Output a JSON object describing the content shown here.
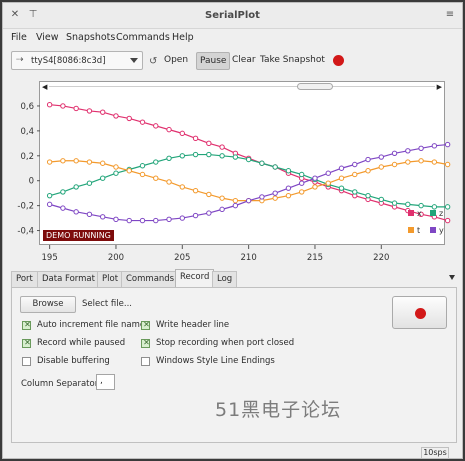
{
  "window": {
    "title": "SerialPlot",
    "close_glyph": "✕",
    "pin_glyph": "⊤",
    "menu_glyph": "≡"
  },
  "menubar": [
    "File",
    "View",
    "Snapshots",
    "Commands",
    "Help"
  ],
  "toolbar": {
    "port": "ttyS4[8086:8c3d]",
    "usb_glyph": "⇢",
    "refresh_glyph": "↺",
    "open_label": "Open",
    "pause_label": "Pause",
    "clear_label": "Clear",
    "snapshot_label": "Take Snapshot",
    "record_color": "#d21818"
  },
  "plot_status": "DEMO RUNNING",
  "scroll": {
    "left_arrow": "◀",
    "right_arrow": "▶"
  },
  "chart_data": {
    "type": "line",
    "xlim": [
      194.5,
      224.5
    ],
    "ylim": [
      -0.5,
      0.72
    ],
    "x_ticks": [
      195,
      200,
      205,
      210,
      215,
      220
    ],
    "y_ticks": [
      0.6,
      0.4,
      0.2,
      0,
      -0.2,
      -0.4
    ],
    "y_tick_labels": [
      "0,6",
      "0,4",
      "0,2",
      "0",
      "-0,2",
      "-0,4"
    ],
    "grid": false,
    "legend": "bottom-right",
    "series": [
      {
        "name": "x",
        "color": "#e0306e",
        "start": 195,
        "step": 1,
        "values": [
          0.61,
          0.6,
          0.58,
          0.56,
          0.55,
          0.52,
          0.5,
          0.47,
          0.44,
          0.41,
          0.38,
          0.34,
          0.3,
          0.27,
          0.22,
          0.18,
          0.14,
          0.11,
          0.06,
          0.02,
          -0.01,
          -0.05,
          -0.08,
          -0.12,
          -0.15,
          -0.18,
          -0.21,
          -0.24,
          -0.27,
          -0.29,
          -0.32
        ]
      },
      {
        "name": "z",
        "color": "#22a57a",
        "start": 195,
        "step": 1,
        "values": [
          -0.12,
          -0.09,
          -0.05,
          -0.02,
          0.02,
          0.06,
          0.09,
          0.12,
          0.15,
          0.18,
          0.2,
          0.21,
          0.21,
          0.2,
          0.19,
          0.17,
          0.14,
          0.11,
          0.08,
          0.05,
          0.01,
          -0.03,
          -0.06,
          -0.09,
          -0.12,
          -0.15,
          -0.18,
          -0.19,
          -0.2,
          -0.21,
          -0.21
        ]
      },
      {
        "name": "t",
        "color": "#f39a2d",
        "start": 195,
        "step": 1,
        "values": [
          0.15,
          0.16,
          0.16,
          0.15,
          0.14,
          0.11,
          0.08,
          0.05,
          0.02,
          -0.01,
          -0.05,
          -0.08,
          -0.11,
          -0.14,
          -0.16,
          -0.16,
          -0.16,
          -0.14,
          -0.12,
          -0.09,
          -0.05,
          -0.02,
          0.02,
          0.05,
          0.08,
          0.11,
          0.13,
          0.15,
          0.16,
          0.15,
          0.13
        ]
      },
      {
        "name": "y",
        "color": "#7f47c4",
        "start": 195,
        "step": 1,
        "values": [
          -0.19,
          -0.22,
          -0.25,
          -0.27,
          -0.29,
          -0.31,
          -0.32,
          -0.32,
          -0.32,
          -0.31,
          -0.3,
          -0.28,
          -0.26,
          -0.23,
          -0.2,
          -0.16,
          -0.13,
          -0.1,
          -0.06,
          -0.02,
          0.02,
          0.06,
          0.1,
          0.13,
          0.17,
          0.19,
          0.22,
          0.24,
          0.26,
          0.28,
          0.29
        ]
      }
    ]
  },
  "tabs": [
    "Port",
    "Data Format",
    "Plot",
    "Commands",
    "Record",
    "Log"
  ],
  "active_tab": "Record",
  "record": {
    "browse_label": "Browse",
    "select_file": "Select file...",
    "auto_increment": {
      "label": "Auto increment file name",
      "checked": true
    },
    "record_paused": {
      "label": "Record while paused",
      "checked": true
    },
    "disable_buffering": {
      "label": "Disable buffering",
      "checked": false
    },
    "write_header": {
      "label": "Write header line",
      "checked": true
    },
    "stop_on_close": {
      "label": "Stop recording when port closed",
      "checked": true
    },
    "windows_endings": {
      "label": "Windows Style Line Endings",
      "checked": false
    },
    "col_sep_label": "Column Separator:",
    "col_sep_value": ","
  },
  "watermark": "51黑电子论坛",
  "status_rate": "10sps"
}
